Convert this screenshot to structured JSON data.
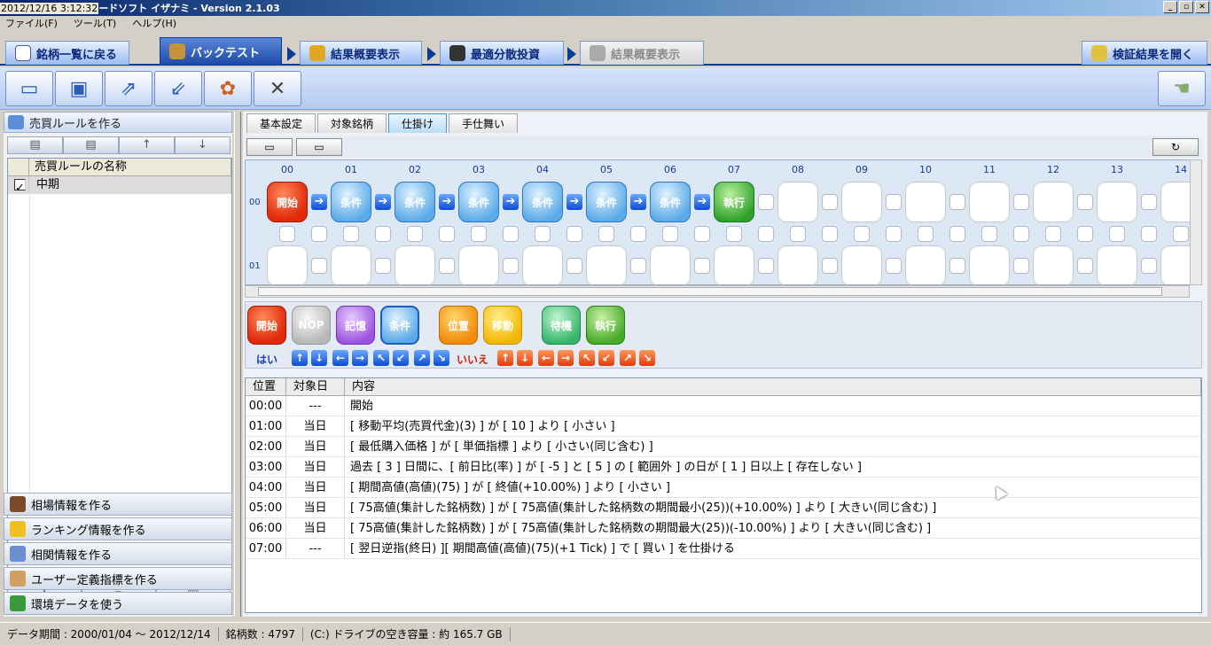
{
  "window": {
    "timestamp": "2012/12/16 3:12:32",
    "title": "ードソフト イザナミ - Version 2.1.03"
  },
  "menu": [
    "ファイル(F)",
    "ツール(T)",
    "ヘルプ(H)"
  ],
  "nav": {
    "back": "銘柄一覧に戻る",
    "backtest": "バックテスト",
    "summary": "結果概要表示",
    "optimize": "最適分散投資",
    "summary2": "結果概要表示",
    "open_results": "検証結果を開く"
  },
  "left": {
    "rules_header": "売買ルールを作る",
    "table_header": "売買ルールの名称",
    "rules": [
      {
        "checked": "✓",
        "name": "中期"
      }
    ],
    "sections": [
      "相場情報を作る",
      "ランキング情報を作る",
      "相関情報を作る",
      "ユーザー定義指標を作る",
      "環境データを使う"
    ]
  },
  "tabs": [
    "基本設定",
    "対象銘柄",
    "仕掛け",
    "手仕舞い"
  ],
  "grid": {
    "columns": [
      "00",
      "01",
      "02",
      "03",
      "04",
      "05",
      "06",
      "07",
      "08",
      "09",
      "10",
      "11",
      "12",
      "13",
      "14"
    ],
    "rows": [
      "00",
      "01"
    ],
    "row0": [
      "開始",
      "条件",
      "条件",
      "条件",
      "条件",
      "条件",
      "条件",
      "執行"
    ]
  },
  "palette": {
    "items": [
      "開始",
      "NOP",
      "記憶",
      "条件",
      "位置",
      "移動",
      "待機",
      "執行"
    ],
    "yes": "はい",
    "no": "いいえ"
  },
  "detail": {
    "headers": [
      "位置",
      "対象日",
      "内容"
    ],
    "rows": [
      {
        "pos": "00:00",
        "day": "---",
        "content": "開始"
      },
      {
        "pos": "01:00",
        "day": "当日",
        "content": "[ 移動平均(売買代金)(3) ] が [ 10 ] より [ 小さい ]"
      },
      {
        "pos": "02:00",
        "day": "当日",
        "content": "[ 最低購入価格 ] が [ 単価指標 ] より [ 小さい(同じ含む) ]"
      },
      {
        "pos": "03:00",
        "day": "当日",
        "content": "過去 [ 3 ] 日間に、[ 前日比(率) ] が [ -5 ] と [ 5 ] の [ 範囲外 ] の日が [ 1 ] 日以上 [ 存在しない ]"
      },
      {
        "pos": "04:00",
        "day": "当日",
        "content": "[ 期間高値(高値)(75) ] が [ 終値(+10.00%) ] より [ 小さい ]"
      },
      {
        "pos": "05:00",
        "day": "当日",
        "content": "[ 75高値(集計した銘柄数) ] が [ 75高値(集計した銘柄数の期間最小(25))(+10.00%) ] より [ 大きい(同じ含む) ]"
      },
      {
        "pos": "06:00",
        "day": "当日",
        "content": "[ 75高値(集計した銘柄数) ] が [ 75高値(集計した銘柄数の期間最大(25))(-10.00%) ] より [ 大きい(同じ含む) ]"
      },
      {
        "pos": "07:00",
        "day": "---",
        "content": "[ 翌日逆指(終日) ][ 期間高値(高値)(75)(+1 Tick) ] で [ 買い ] を仕掛ける"
      }
    ]
  },
  "status": {
    "period": "データ期間 : 2000/01/04 〜 2012/12/14",
    "count": "銘柄数 : 4797",
    "drive": "(C:) ドライブの空き容量 : 約 165.7 GB"
  }
}
